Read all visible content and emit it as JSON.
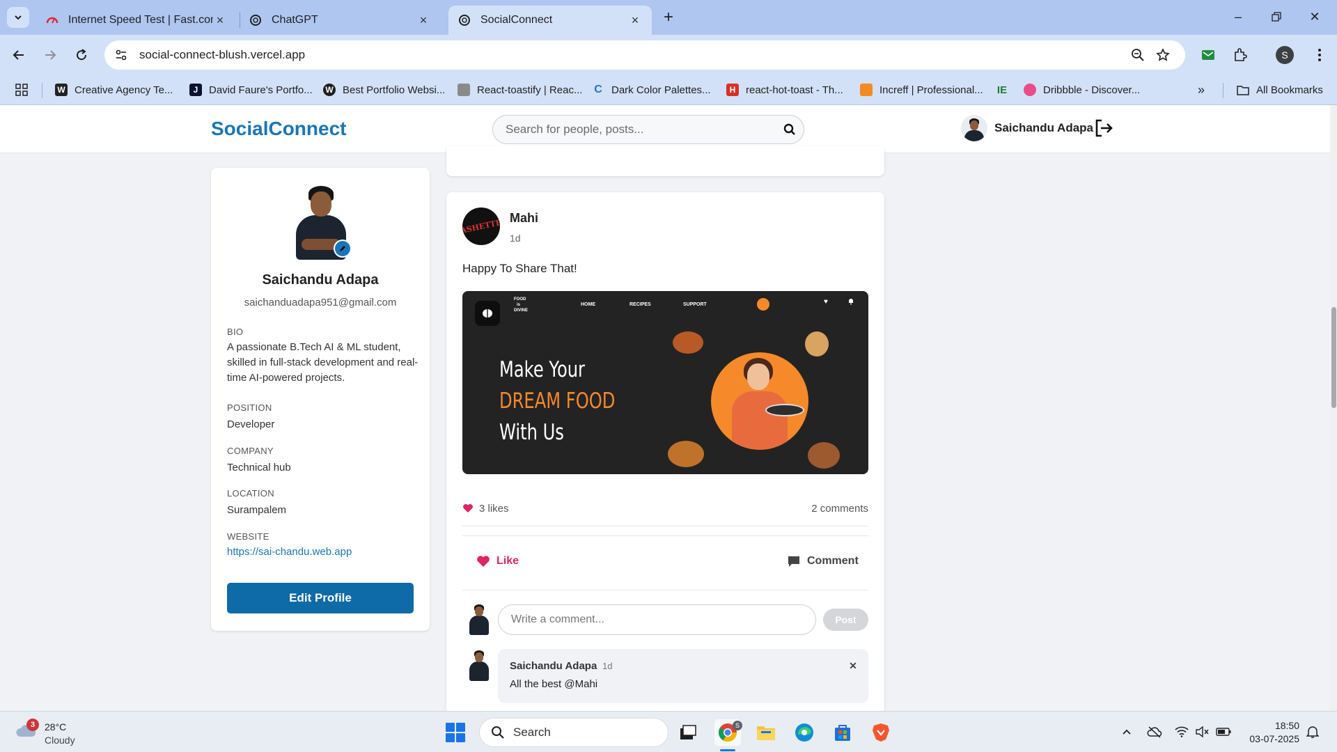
{
  "browser": {
    "tabs": [
      {
        "title": "Internet Speed Test | Fast.com",
        "icon": "speedometer-icon",
        "color": "#e3262b"
      },
      {
        "title": "ChatGPT",
        "icon": "chatgpt-icon",
        "color": "#1f1f1f"
      },
      {
        "title": "SocialConnect",
        "icon": "chatgpt-icon",
        "color": "#1f1f1f",
        "active": true
      }
    ],
    "url": "social-connect-blush.vercel.app",
    "bookmarks": [
      {
        "label": "Creative Agency Te...",
        "color": "#222222",
        "glyph": "W"
      },
      {
        "label": "David Faure's Portfo...",
        "color": "#0c1230",
        "glyph": "J"
      },
      {
        "label": "Best Portfolio Websi...",
        "color": "#1f1f1f",
        "glyph": "W"
      },
      {
        "label": "React-toastify | Reac...",
        "color": "#777777",
        "glyph": ""
      },
      {
        "label": "Dark Color Palettes...",
        "color": "#1a73e8",
        "glyph": "C"
      },
      {
        "label": "react-hot-toast - Th...",
        "color": "#d93025",
        "glyph": "H"
      },
      {
        "label": "Increff | Professional...",
        "color": "#f28b22",
        "glyph": ""
      },
      {
        "label": "",
        "color": "#1e7b34",
        "glyph": "IE"
      },
      {
        "label": "Dribbble - Discover...",
        "color": "#ea4c89",
        "glyph": ""
      }
    ],
    "all_bookmarks": "All Bookmarks",
    "profile_letter": "S"
  },
  "app": {
    "brand": "SocialConnect",
    "search_placeholder": "Search for people, posts...",
    "user_name": "Saichandu Adapa",
    "accent": "#1876b8"
  },
  "profile": {
    "name": "Saichandu Adapa",
    "email": "saichanduadapa951@gmail.com",
    "fields": [
      {
        "label": "BIO",
        "value": "A passionate B.Tech AI & ML student, skilled in full-stack development and real-time AI-powered projects."
      },
      {
        "label": "POSITION",
        "value": "Developer"
      },
      {
        "label": "COMPANY",
        "value": "Technical hub"
      },
      {
        "label": "LOCATION",
        "value": "Surampalem"
      },
      {
        "label": "WEBSITE",
        "value": "https://sai-chandu.web.app"
      }
    ],
    "edit_button": "Edit Profile"
  },
  "post": {
    "author": "Mahi",
    "author_logo_text": "ASHETTE",
    "time": "1d",
    "text": "Happy To Share That!",
    "image": {
      "brand_lines": [
        "FOOD",
        "is",
        "DIVINE"
      ],
      "nav": [
        "HOME",
        "RECIPES",
        "SUPPORT"
      ],
      "headline": [
        "Make Your",
        "DREAM FOOD",
        "With Us"
      ],
      "accent": "#f6892a"
    },
    "likes": "3 likes",
    "comments_count": "2 comments",
    "like_label": "Like",
    "comment_label": "Comment",
    "comment_placeholder": "Write a comment...",
    "post_button": "Post",
    "comments": [
      {
        "author": "Saichandu Adapa",
        "time": "1d",
        "text": "All the best @Mahi"
      }
    ]
  },
  "taskbar": {
    "weather_temp": "28°C",
    "weather_cond": "Cloudy",
    "weather_badge": "3",
    "search_label": "Search",
    "time": "18:50",
    "date": "03-07-2025",
    "chrome_badge": "S"
  }
}
